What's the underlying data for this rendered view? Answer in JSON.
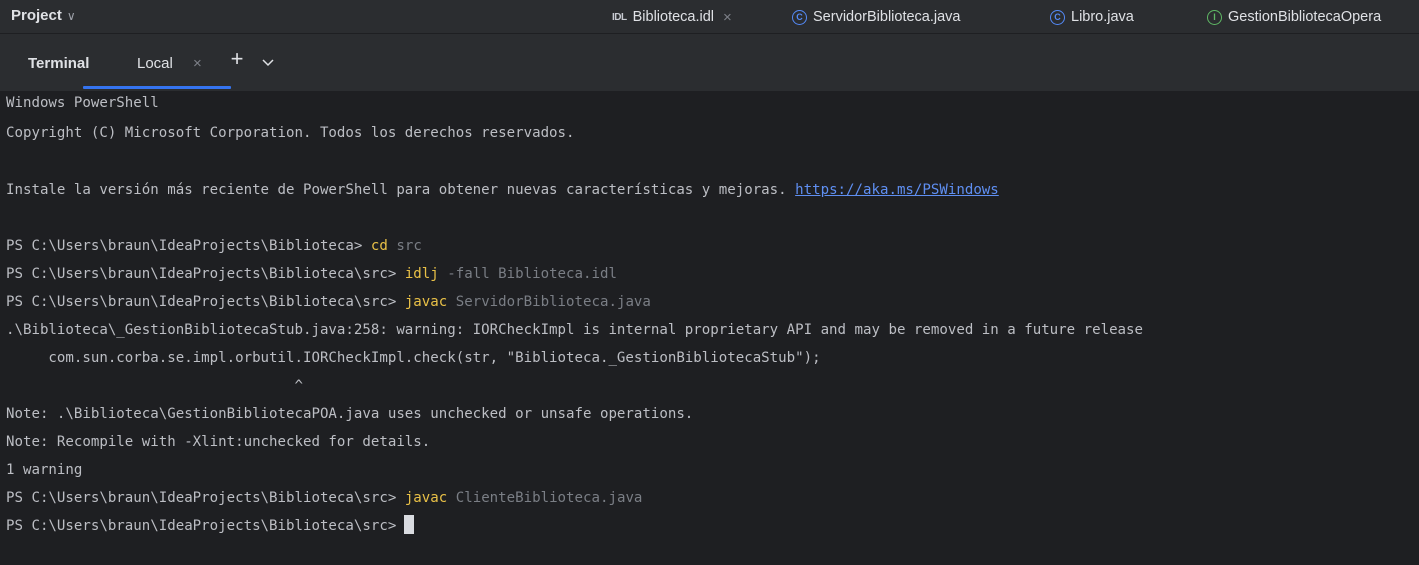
{
  "header": {
    "project_label": "Project",
    "tabs": [
      {
        "icon": "idl-file-icon",
        "icon_text": "IDL",
        "label": "Biblioteca.idl",
        "close": "×"
      },
      {
        "icon": "java-class-icon",
        "icon_text": "C",
        "label": "ServidorBiblioteca.java"
      },
      {
        "icon": "java-class-icon",
        "icon_text": "C",
        "label": "Libro.java"
      },
      {
        "icon": "java-interface-icon",
        "icon_text": "I",
        "label": "GestionBibliotecaOpera"
      }
    ]
  },
  "terminal": {
    "title": "Terminal",
    "tab_label": "Local",
    "tab_close": "×",
    "add_button": "+",
    "lines": {
      "l01": "Windows PowerShell",
      "l02": "Copyright (C) Microsoft Corporation. Todos los derechos reservados.",
      "l04_text": "Instale la versión más reciente de PowerShell para obtener nuevas características y mejoras. ",
      "l04_link": "https://aka.ms/PSWindows",
      "l06_prompt": "PS C:\\Users\\braun\\IdeaProjects\\Biblioteca> ",
      "l06_cmd": "cd",
      "l06_arg": " src",
      "l07_prompt": "PS C:\\Users\\braun\\IdeaProjects\\Biblioteca\\src> ",
      "l07_cmd": "idlj",
      "l07_arg": " -fall Biblioteca.idl",
      "l08_prompt": "PS C:\\Users\\braun\\IdeaProjects\\Biblioteca\\src> ",
      "l08_cmd": "javac",
      "l08_arg": " ServidorBiblioteca.java",
      "l09": ".\\Biblioteca\\_GestionBibliotecaStub.java:258: warning: IORCheckImpl is internal proprietary API and may be removed in a future release",
      "l10": "     com.sun.corba.se.impl.orbutil.IORCheckImpl.check(str, \"Biblioteca._GestionBibliotecaStub\");",
      "l11": "                                  ^",
      "l12": "Note: .\\Biblioteca\\GestionBibliotecaPOA.java uses unchecked or unsafe operations.",
      "l13": "Note: Recompile with -Xlint:unchecked for details.",
      "l14": "1 warning",
      "l15_prompt": "PS C:\\Users\\braun\\IdeaProjects\\Biblioteca\\src> ",
      "l15_cmd": "javac",
      "l15_arg": " ClienteBiblioteca.java",
      "l16_prompt": "PS C:\\Users\\braun\\IdeaProjects\\Biblioteca\\src>"
    }
  },
  "colors": {
    "background": "#1e1f22",
    "toolbar": "#2b2d30",
    "command": "#e8c047",
    "argument": "#7a7e85",
    "link": "#5f8ff2",
    "active_tab_accent": "#3574f0"
  }
}
